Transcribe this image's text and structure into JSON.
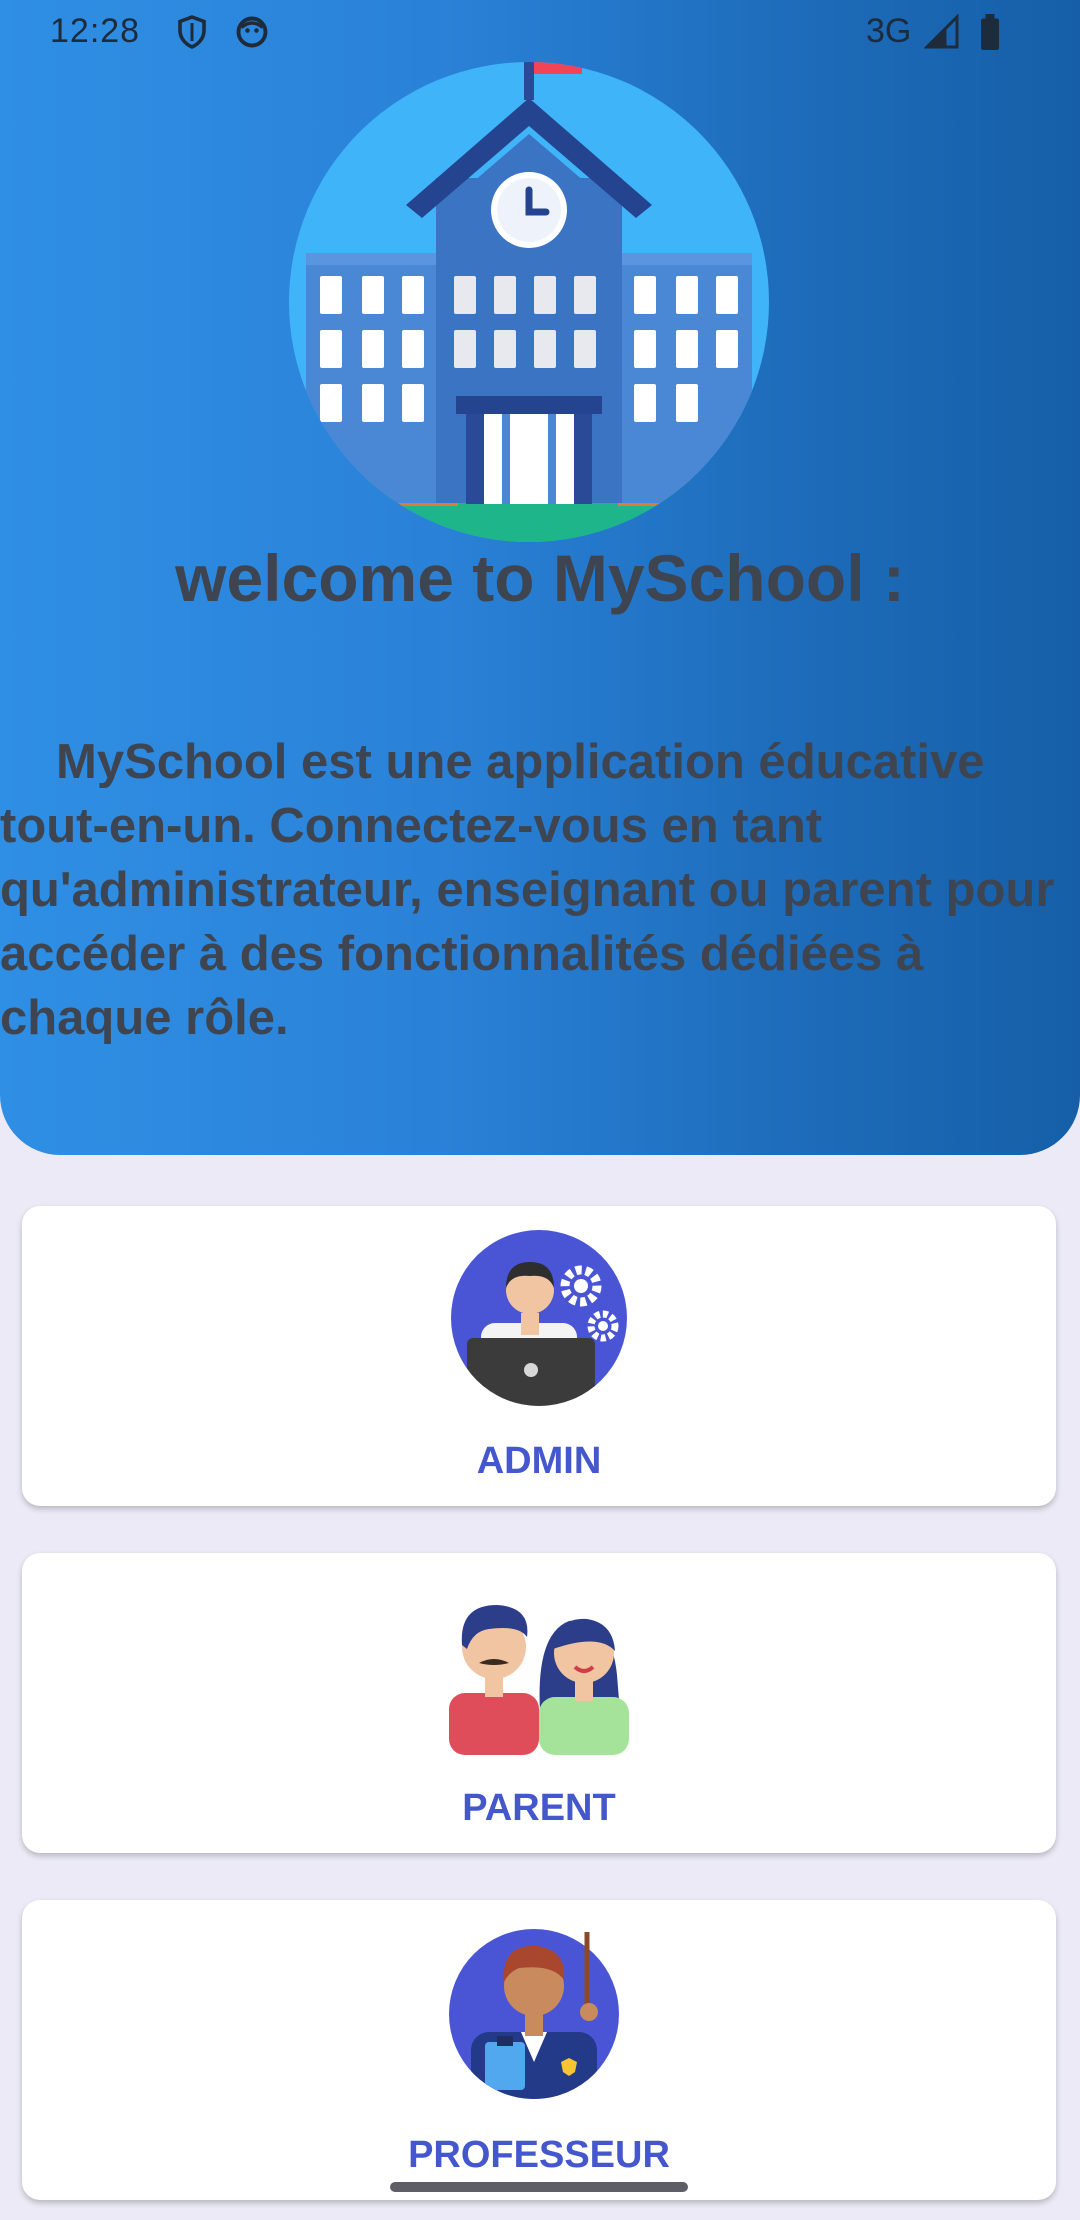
{
  "status_bar": {
    "time": "12:28",
    "network": "3G"
  },
  "hero": {
    "welcome_title": "welcome to MySchool :",
    "description": "MySchool est une application éducative tout-en-un. Connectez-vous en tant qu'administrateur, enseignant ou parent pour accéder à des fonctionnalités dédiées à chaque rôle."
  },
  "roles": [
    {
      "label": "ADMIN",
      "icon": "admin-icon"
    },
    {
      "label": "PARENT",
      "icon": "parent-icon"
    },
    {
      "label": "PROFESSEUR",
      "icon": "teacher-icon"
    }
  ],
  "colors": {
    "hero_gradient_start": "#2f8fe4",
    "hero_gradient_end": "#165fa8",
    "accent": "#4557cc",
    "background": "#ebeaf6",
    "text_dark": "#3e4550"
  }
}
